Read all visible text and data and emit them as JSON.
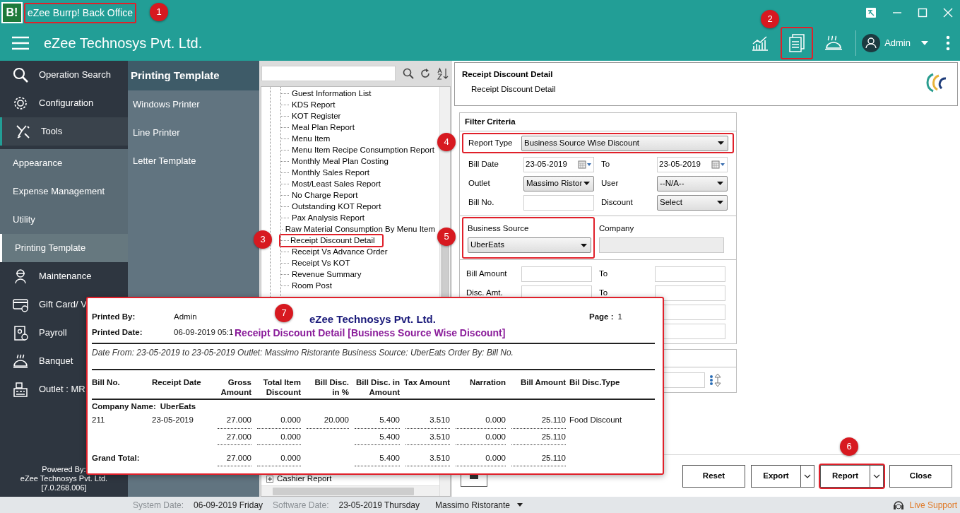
{
  "window": {
    "logo": "B!",
    "title": "eZee Burrp! Back Office",
    "highlighted": true
  },
  "header": {
    "company": "eZee Technosys Pvt. Ltd.",
    "toolbar": [
      {
        "kind": "chart",
        "highlighted": false
      },
      {
        "kind": "report",
        "highlighted": true
      },
      {
        "kind": "banquet",
        "highlighted": false
      }
    ],
    "user": "Admin"
  },
  "sidebar": {
    "items": [
      {
        "label": "Operation Search",
        "kind": "main",
        "selected": false
      },
      {
        "label": "Configuration",
        "kind": "main",
        "selected": false
      },
      {
        "label": "Tools",
        "kind": "main",
        "selected": true
      },
      {
        "label": "Appearance",
        "kind": "sub",
        "selected": false
      },
      {
        "label": "Expense Management",
        "kind": "sub",
        "selected": false
      },
      {
        "label": "Utility",
        "kind": "sub",
        "selected": false
      },
      {
        "label": "Printing Template",
        "kind": "sub",
        "selected": true
      },
      {
        "label": "Maintenance",
        "kind": "main",
        "selected": false
      },
      {
        "label": "Gift Card/ V",
        "kind": "main",
        "selected": false
      },
      {
        "label": "Payroll",
        "kind": "main",
        "selected": false
      },
      {
        "label": "Banquet",
        "kind": "main",
        "selected": false
      },
      {
        "label": "Outlet : MR",
        "kind": "main",
        "selected": false
      }
    ],
    "footer": [
      "Powered By:",
      "eZee Technosys Pvt. Ltd.",
      "[7.0.268.006]"
    ]
  },
  "submenu": {
    "title": "Printing Template",
    "items": [
      "Windows Printer",
      "Line Printer",
      "Letter Template"
    ]
  },
  "report_tree": {
    "items": [
      {
        "label": "Guest Information List",
        "highlighted": false
      },
      {
        "label": "KDS Report",
        "highlighted": false
      },
      {
        "label": "KOT Register",
        "highlighted": false
      },
      {
        "label": "Meal Plan Report",
        "highlighted": false
      },
      {
        "label": "Menu Item",
        "highlighted": false
      },
      {
        "label": "Menu Item Recipe Consumption Report",
        "highlighted": false
      },
      {
        "label": "Monthly Meal Plan Costing",
        "highlighted": false
      },
      {
        "label": "Monthly Sales Report",
        "highlighted": false
      },
      {
        "label": "Most/Least Sales Report",
        "highlighted": false
      },
      {
        "label": "No Charge Report",
        "highlighted": false
      },
      {
        "label": "Outstanding KOT Report",
        "highlighted": false
      },
      {
        "label": "Pax Analysis Report",
        "highlighted": false
      },
      {
        "label": "Raw Material Consumption By Menu Item",
        "highlighted": false
      },
      {
        "label": "Receipt Discount Detail",
        "highlighted": true
      },
      {
        "label": "Receipt Vs Advance Order",
        "highlighted": false
      },
      {
        "label": "Receipt Vs KOT",
        "highlighted": false
      },
      {
        "label": "Revenue Summary",
        "highlighted": false
      },
      {
        "label": "Room Post",
        "highlighted": false
      }
    ],
    "groups": [
      {
        "label": "Cashier Report",
        "expanded": false
      }
    ]
  },
  "report_header": {
    "title": "Receipt Discount Detail",
    "subtitle": "Receipt Discount Detail"
  },
  "filter": {
    "title": "Filter Criteria",
    "report_type": {
      "label": "Report Type",
      "value": "Business Source Wise Discount",
      "highlighted": true
    },
    "bill_date": {
      "label": "Bill Date",
      "from": "23-05-2019",
      "to_label": "To",
      "to": "23-05-2019"
    },
    "outlet": {
      "label": "Outlet",
      "value": "Massimo Ristor"
    },
    "user": {
      "label": "User",
      "value": "--N/A--"
    },
    "bill_no": {
      "label": "Bill No."
    },
    "discount": {
      "label": "Discount",
      "value": "Select"
    },
    "business_source": {
      "label": "Business Source",
      "value": "UberEats",
      "highlighted": true
    },
    "company": {
      "label": "Company",
      "disabled": true
    },
    "bill_amount": {
      "label": "Bill Amount",
      "to_label": "To"
    },
    "disc_amt": {
      "label": "Disc. Amt.",
      "to_label": "To"
    }
  },
  "buttons": [
    {
      "label": "Reset",
      "dropdown": false,
      "highlighted": false
    },
    {
      "label": "Export",
      "dropdown": true,
      "highlighted": false
    },
    {
      "label": "Report",
      "dropdown": true,
      "highlighted": true
    },
    {
      "label": "Close",
      "dropdown": false,
      "highlighted": false
    }
  ],
  "report_preview": {
    "printed_by_label": "Printed By:",
    "printed_by": "Admin",
    "printed_date_label": "Printed Date:",
    "printed_date": "06-09-2019 05:1",
    "company": "eZee Technosys Pvt. Ltd.",
    "page_label": "Page :",
    "page": "1",
    "title": "Receipt Discount Detail [Business Source Wise Discount]",
    "criteria": "Date From: 23-05-2019 to 23-05-2019 Outlet: Massimo Ristorante Business Source: UberEats Order By: Bill No.",
    "columns": [
      "Bill No.",
      "Receipt Date",
      "Gross Amount",
      "Total Item Discount",
      "Bill Disc. in %",
      "Bill Disc. in Amount",
      "Tax Amount",
      "Narration",
      "Bill Amount",
      "Bil Disc.Type"
    ],
    "group_label": "Company Name:",
    "group_value": "UberEats",
    "rows": [
      [
        "211",
        "23-05-2019",
        "27.000",
        "0.000",
        "20.000",
        "5.400",
        "3.510",
        "0.000",
        "25.110",
        "Food Discount"
      ]
    ],
    "subtotal": {
      "gross_amount": "27.000",
      "total_item_discount": "0.000",
      "bill_disc_amount": "5.400",
      "tax_amount": "3.510",
      "narration": "0.000",
      "bill_amount": "25.110"
    },
    "grand_total_label": "Grand Total:",
    "grand_total": {
      "gross_amount": "27.000",
      "total_item_discount": "0.000",
      "bill_disc_amount": "5.400",
      "tax_amount": "3.510",
      "narration": "0.000",
      "bill_amount": "25.110"
    }
  },
  "status_bar": {
    "system_date_label": "System Date:",
    "system_date": "06-09-2019 Friday",
    "software_date_label": "Software Date:",
    "software_date": "23-05-2019 Thursday",
    "outlet": "Massimo Ristorante",
    "live_support": "Live Support"
  },
  "callouts": [
    "1",
    "2",
    "3",
    "4",
    "5",
    "6",
    "7"
  ]
}
